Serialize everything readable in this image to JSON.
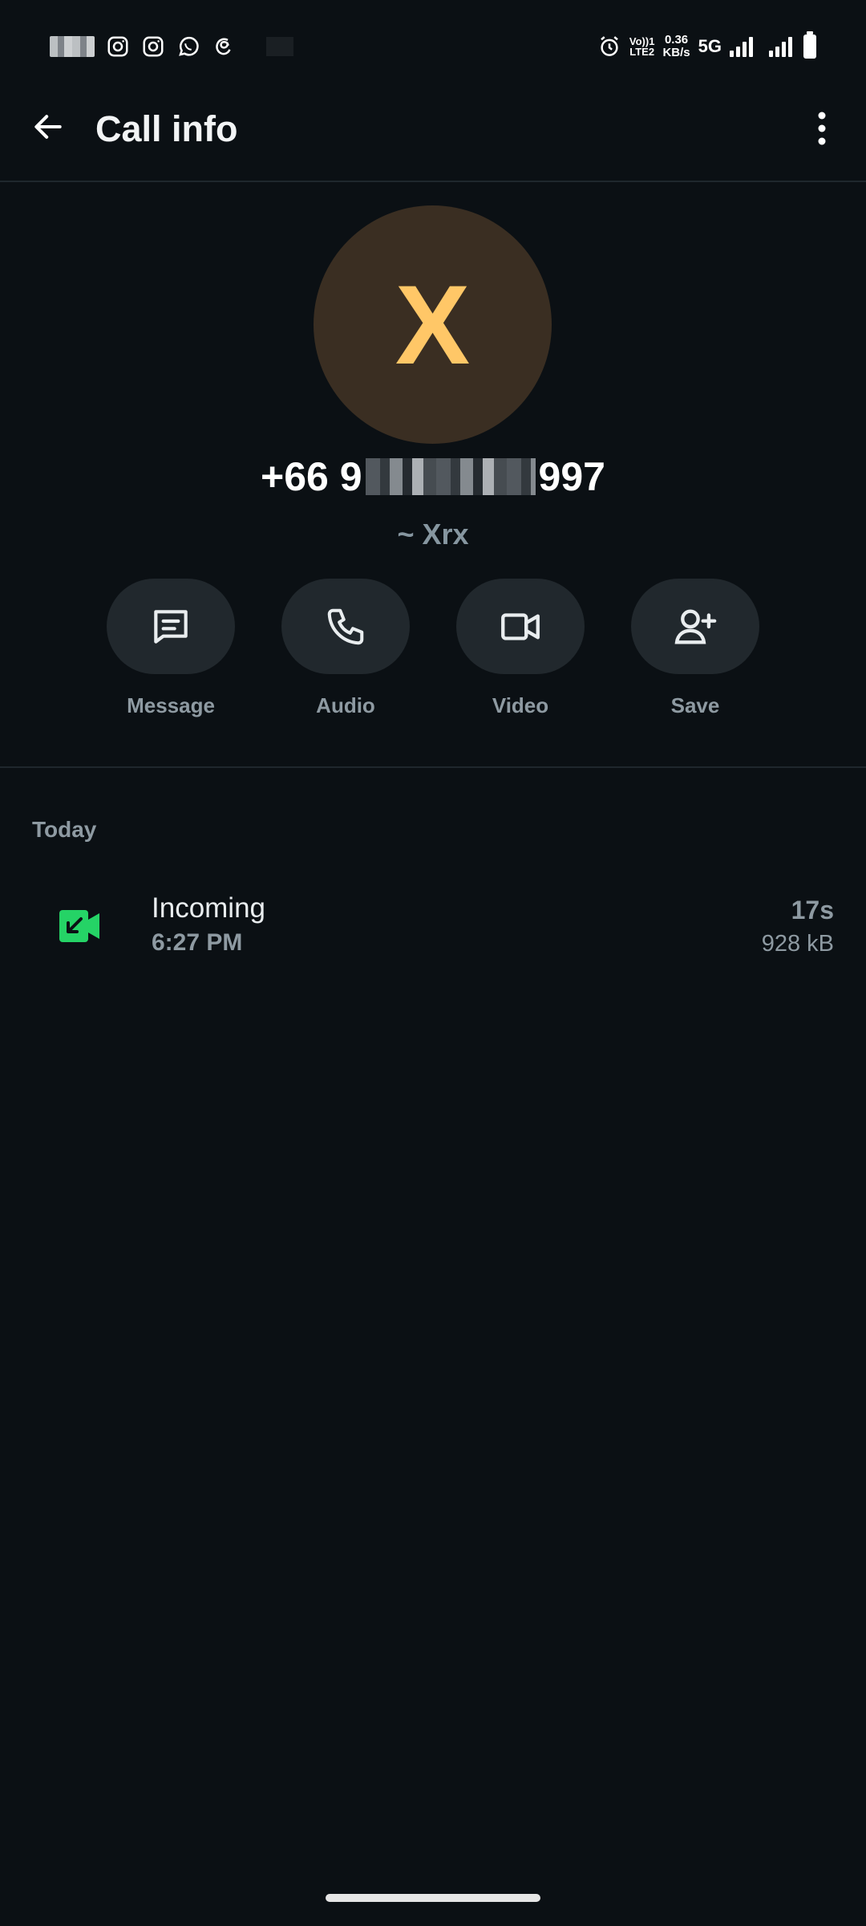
{
  "status_bar": {
    "volte_top": "Vo))1",
    "volte_bottom": "LTE2",
    "speed_value": "0.36",
    "speed_unit": "KB/s",
    "network": "5G"
  },
  "header": {
    "title": "Call info",
    "back_icon": "arrow-left-icon",
    "more_icon": "more-vertical-icon"
  },
  "contact": {
    "avatar_letter": "X",
    "avatar_bg": "#3a2e22",
    "avatar_fg": "#ffc767",
    "phone_prefix": "+66 9",
    "phone_suffix": "997",
    "alias": "~ Xrx"
  },
  "actions": [
    {
      "label": "Message",
      "icon": "message-icon"
    },
    {
      "label": "Audio",
      "icon": "phone-icon"
    },
    {
      "label": "Video",
      "icon": "video-icon"
    },
    {
      "label": "Save",
      "icon": "add-contact-icon"
    }
  ],
  "calls": {
    "section": "Today",
    "items": [
      {
        "type": "Incoming",
        "time": "6:27 PM",
        "duration": "17s",
        "size": "928 kB",
        "icon": "incoming-video-call-icon",
        "icon_color": "#25d366"
      }
    ]
  }
}
